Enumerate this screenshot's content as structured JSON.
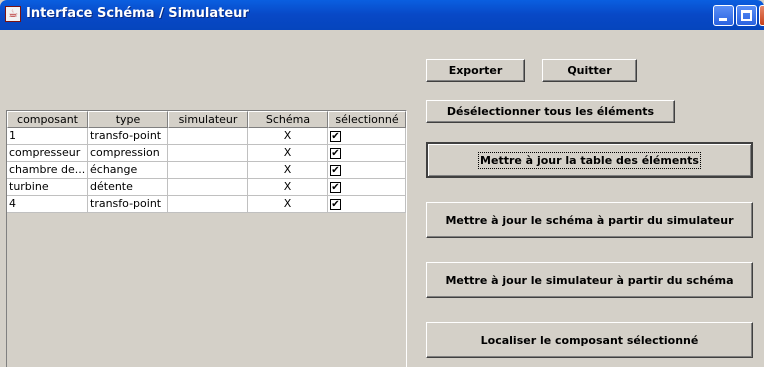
{
  "window": {
    "title": "Interface Schéma / Simulateur"
  },
  "buttons": {
    "exporter": "Exporter",
    "quitter": "Quitter",
    "deselect_all": "Désélectionner tous les éléments",
    "update_table": "Mettre à jour la table des éléments",
    "update_schema": "Mettre à jour le schéma à partir du simulateur",
    "update_sim": "Mettre à jour le simulateur à partir du schéma",
    "locate": "Localiser le composant sélectionné"
  },
  "table": {
    "columns": [
      "composant",
      "type",
      "simulateur",
      "Schéma",
      "sélectionné"
    ],
    "rows": [
      {
        "composant": "1",
        "type": "transfo-point",
        "simulateur": "",
        "schema": "X",
        "selectionne": true
      },
      {
        "composant": "compresseur",
        "type": "compression",
        "simulateur": "",
        "schema": "X",
        "selectionne": true
      },
      {
        "composant": "chambre de...",
        "type": "échange",
        "simulateur": "",
        "schema": "X",
        "selectionne": true
      },
      {
        "composant": "turbine",
        "type": "détente",
        "simulateur": "",
        "schema": "X",
        "selectionne": true
      },
      {
        "composant": "4",
        "type": "transfo-point",
        "simulateur": "",
        "schema": "X",
        "selectionne": true
      }
    ]
  },
  "icons": {
    "app": "java-cup-icon",
    "minimize": "minimize-icon",
    "maximize": "maximize-icon",
    "close": "close-icon",
    "check": "checkmark-icon"
  }
}
